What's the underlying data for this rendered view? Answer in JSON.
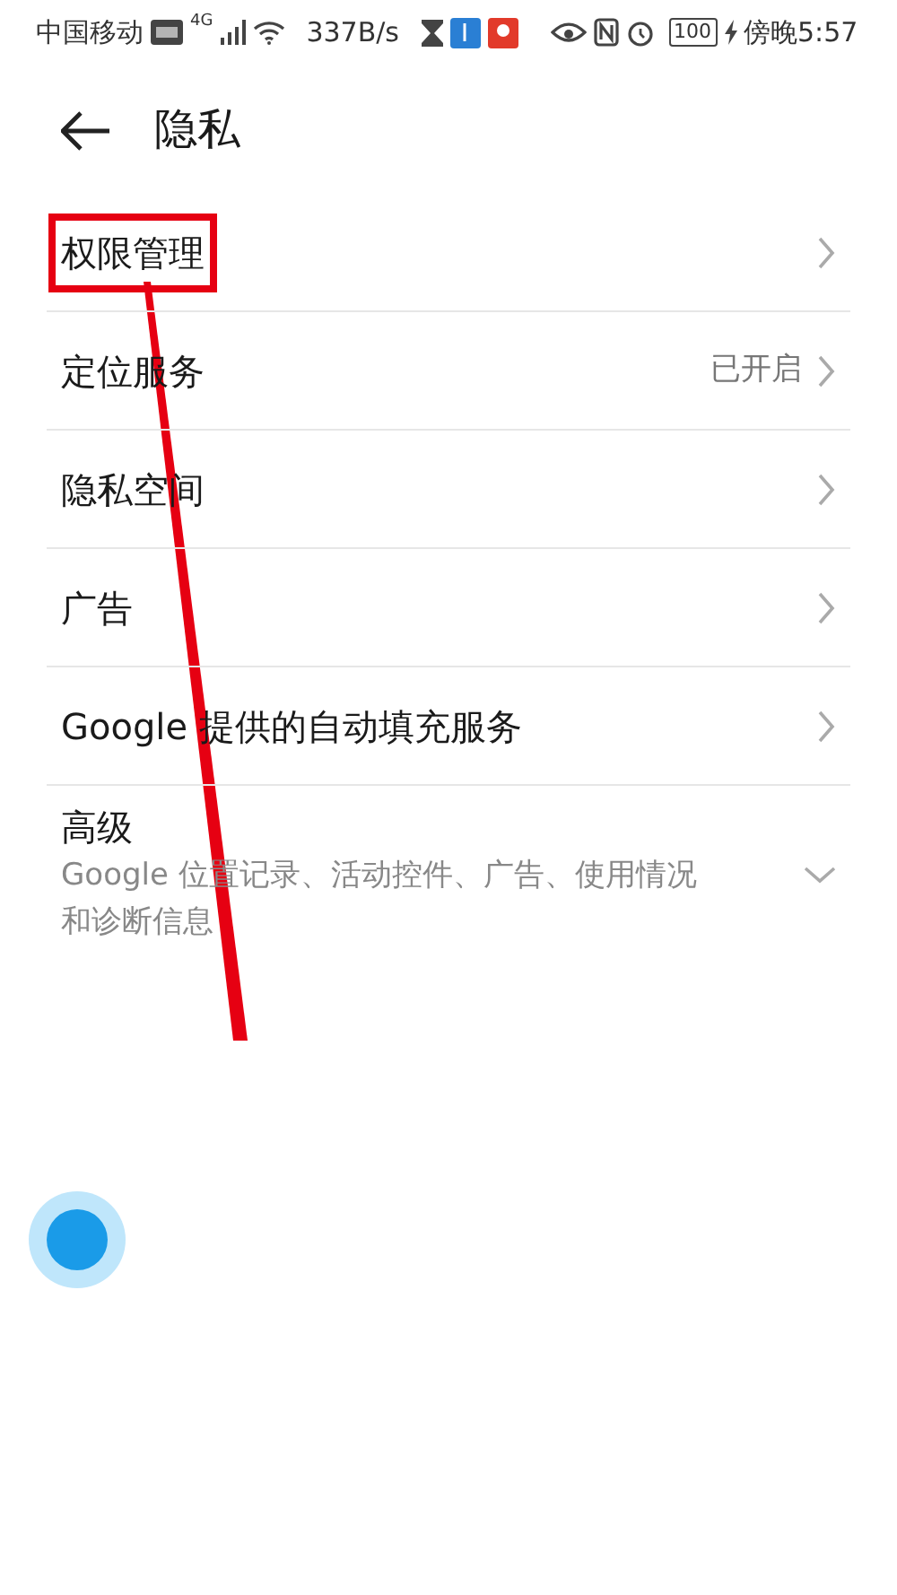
{
  "status_bar": {
    "carrier": "中国移动",
    "network": "4G",
    "speed": "337B/s",
    "battery": "100",
    "time": "傍晚5:57"
  },
  "header": {
    "title": "隐私"
  },
  "items": [
    {
      "kind": "link",
      "label": "权限管理",
      "highlighted": true
    },
    {
      "kind": "link",
      "label": "定位服务",
      "value": "已开启",
      "highlighted": false
    },
    {
      "kind": "link",
      "label": "隐私空间",
      "highlighted": false
    },
    {
      "kind": "link",
      "label": "广告",
      "highlighted": false
    },
    {
      "kind": "link",
      "label": "Google 提供的自动填充服务",
      "highlighted": false
    },
    {
      "kind": "expand",
      "label": "高级",
      "description": "Google 位置记录、活动控件、广告、使用情况和诊断信息",
      "highlighted": false
    }
  ]
}
